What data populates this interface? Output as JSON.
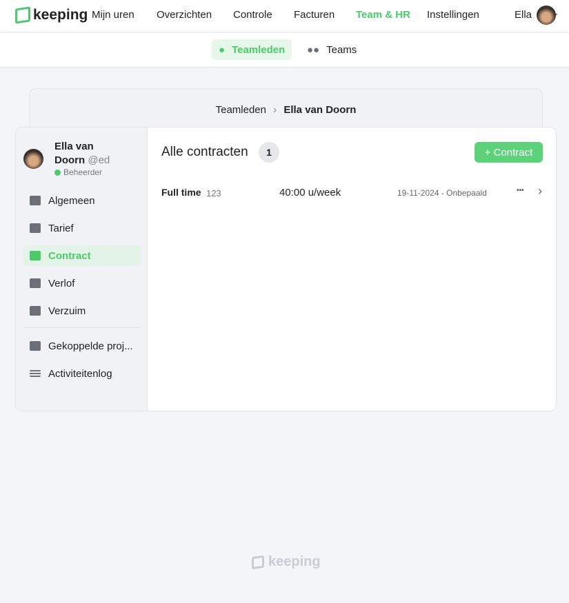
{
  "header": {
    "brand": "keeping",
    "nav": [
      {
        "label": "Mijn uren"
      },
      {
        "label": "Overzichten"
      },
      {
        "label": "Controle"
      },
      {
        "label": "Facturen"
      },
      {
        "label": "Team & HR",
        "active": true
      },
      {
        "label": "Instellingen"
      }
    ],
    "user": "Ella"
  },
  "subnav": [
    {
      "label": "Teamleden",
      "active": true,
      "icon": "person-icon"
    },
    {
      "label": "Teams",
      "icon": "people-icon"
    }
  ],
  "breadcrumb": {
    "parent": "Teamleden",
    "current": "Ella van Doorn"
  },
  "profile": {
    "name_line1": "Ella van",
    "name_line2": "Doorn",
    "handle": "@ed",
    "role": "Beheerder"
  },
  "sidebar": {
    "items": [
      {
        "label": "Algemeen"
      },
      {
        "label": "Tarief"
      },
      {
        "label": "Contract",
        "active": true
      },
      {
        "label": "Verlof"
      },
      {
        "label": "Verzuim"
      },
      {
        "label": "Gekoppelde proj..."
      },
      {
        "label": "Activiteitenlog"
      }
    ]
  },
  "main": {
    "title": "Alle contracten",
    "count": "1",
    "add_button": "+ Contract",
    "contracts": [
      {
        "type": "Full time",
        "number": "123",
        "hours": "40:00 u/week",
        "period": "19-11-2024 - Onbepaald",
        "more": "•••",
        "chevron": "›"
      }
    ]
  },
  "footer": {
    "brand": "keeping"
  },
  "colors": {
    "accent": "#4cc96a"
  }
}
